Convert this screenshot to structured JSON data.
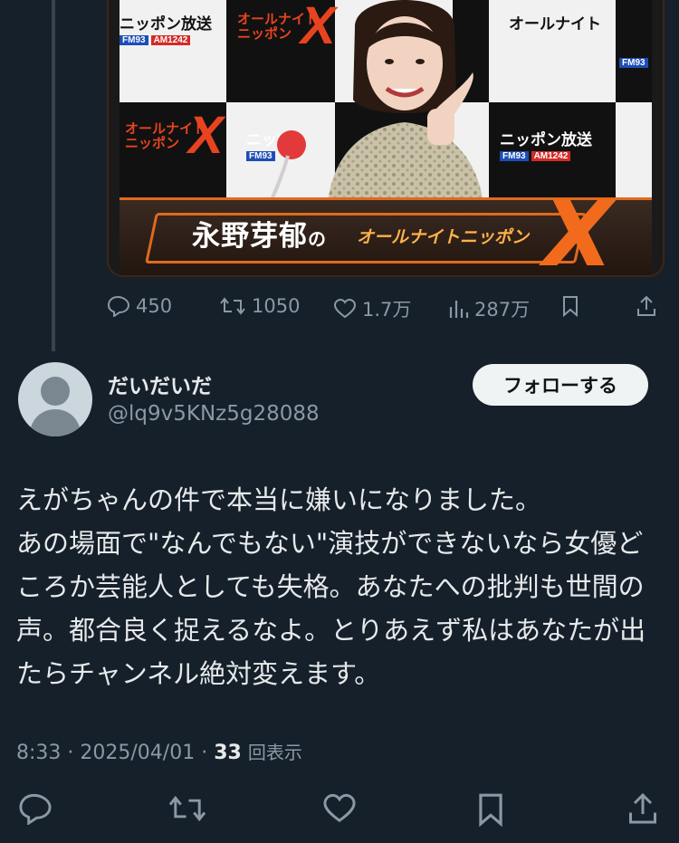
{
  "media": {
    "logo_nippon": "ニッポン放送",
    "logo_nippon_partial": "ニッポ",
    "fm": "FM93",
    "am": "AM1242",
    "ann_line1": "オールナイト",
    "ann_line2": "ニッポン",
    "ann_x": "X",
    "banner_name": "永野芽郁",
    "banner_no": "の",
    "banner_title": "オールナイトニッポン",
    "banner_x": "X"
  },
  "metrics": {
    "replies": "450",
    "retweets": "1050",
    "likes": "1.7万",
    "views": "287万"
  },
  "author": {
    "name": "だいだいだ",
    "handle": "@lq9v5KNz5g28088",
    "follow_label": "フォローする"
  },
  "post": {
    "text": "えがちゃんの件で本当に嫌いになりました。\nあの場面で\"なんでもない\"演技ができないなら女優どころか芸能人としても失格。あなたへの批判も世間の声。都合良く捉えるなよ。とりあえず私はあなたが出たらチャンネル絶対変えます。",
    "time": "8:33",
    "date": "2025/04/01",
    "view_count": "33",
    "view_label": "回表示"
  },
  "colors": {
    "background": "#15202b",
    "text": "#e7e9ea",
    "secondary": "#8b98a5"
  },
  "icons": [
    "reply-icon",
    "retweet-icon",
    "like-icon",
    "views-icon",
    "bookmark-icon",
    "share-icon"
  ]
}
